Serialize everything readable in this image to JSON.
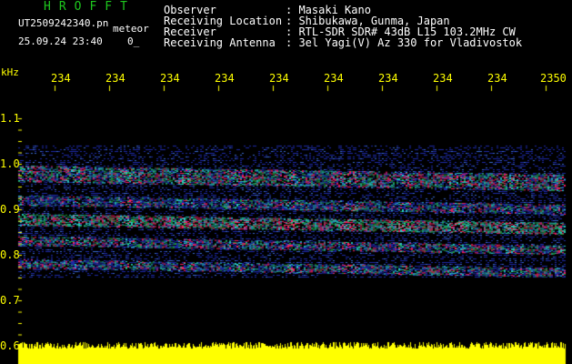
{
  "header": {
    "brand": "HROFFT",
    "filename": "UT2509242340.pn",
    "file_tag": "meteor",
    "datetime": "25.09.24 23:40",
    "extra": "0_",
    "fields": [
      {
        "label": "Observer",
        "value": ": Masaki Kano"
      },
      {
        "label": "Receiving Location",
        "value": ": Shibukawa, Gunma, Japan"
      },
      {
        "label": "Receiver",
        "value": ": RTL-SDR SDR# 43dB L15 103.2MHz CW"
      },
      {
        "label": "Receiving Antenna",
        "value": ": 3el Yagi(V) Az 330 for Vladivostok"
      }
    ]
  },
  "axes": {
    "y_unit": "kHz",
    "y_ticks": [
      "1.1",
      "1.0",
      "0.9",
      "0.8",
      "0.7",
      "0.6"
    ],
    "x_ticks": [
      "234",
      "234",
      "234",
      "234",
      "234",
      "234",
      "234",
      "234",
      "234",
      "2350"
    ]
  },
  "colors": {
    "background": "#000000",
    "title_green": "#1ec81e",
    "text_white": "#ffffff",
    "axis_yellow": "#ffff00",
    "noise_blue": "#1e2aa8",
    "signal_cyan": "#28d0c8",
    "signal_red": "#ff2060"
  },
  "spectrogram": {
    "bands_khz": [
      {
        "freq_start": 0.996,
        "freq_end": 0.96,
        "level": 0.75
      },
      {
        "freq_start": 0.93,
        "freq_end": 0.91,
        "level": 0.5
      },
      {
        "freq_start": 0.89,
        "freq_end": 0.865,
        "level": 1.0
      },
      {
        "freq_start": 0.84,
        "freq_end": 0.82,
        "level": 0.65
      },
      {
        "freq_start": 0.79,
        "freq_end": 0.77,
        "level": 0.6
      }
    ]
  }
}
